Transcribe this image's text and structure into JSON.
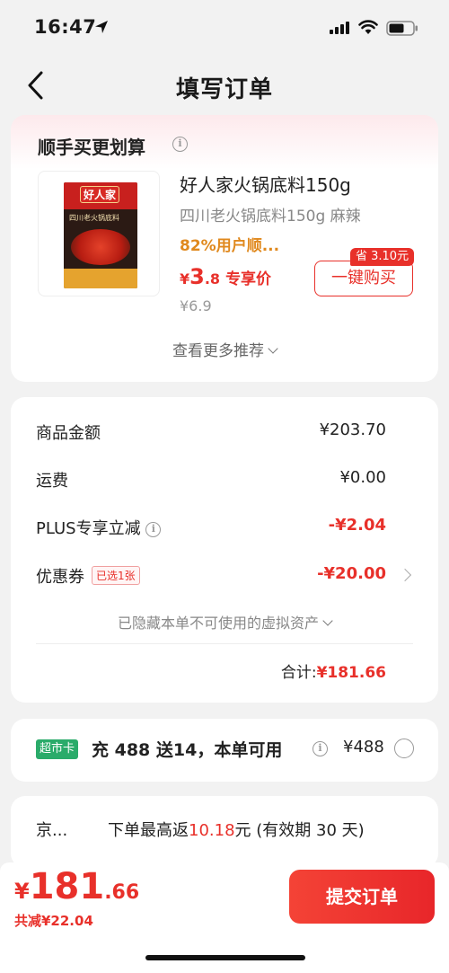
{
  "status": {
    "time": "16:47"
  },
  "nav": {
    "title": "填写订单"
  },
  "recommend": {
    "title": "顺手买更划算",
    "product": {
      "name": "好人家火锅底料150g",
      "subtitle": "四川老火锅底料150g 麻辣",
      "rating": "82%用户顺...",
      "price_yen": "¥",
      "price_int": "3",
      "price_dec": ".8",
      "price_tag": "专享价",
      "orig_price": "¥6.9",
      "save_badge": "省 3.10元",
      "buy_label": "一键购买",
      "pkg_brand": "好人家",
      "pkg_name": "四川老火锅底料"
    },
    "more_label": "查看更多推荐"
  },
  "summary": {
    "rows": [
      {
        "label": "商品金额",
        "value": "¥203.70"
      },
      {
        "label": "运费",
        "value": "¥0.00"
      },
      {
        "label": "PLUS专享立减",
        "value": "-¥2.04"
      },
      {
        "label": "优惠券",
        "badge": "已选1张",
        "value": "-¥20.00"
      }
    ],
    "hidden_assets": "已隐藏本单不可使用的虚拟资产",
    "total_label": "合计:",
    "total_value": "¥181.66"
  },
  "vip": {
    "tag": "超市卡",
    "text": "充 488 送14，本单可用",
    "price": "¥488"
  },
  "rebate": {
    "left": "京...",
    "prefix": "下单最高返",
    "amount": "10.18",
    "suffix": "元 (有效期 30 天)"
  },
  "footer": {
    "yen": "¥",
    "price_int": "181",
    "price_dec": ".66",
    "saved": "共减¥22.04",
    "submit_label": "提交订单"
  },
  "colors": {
    "accent": "#e8302a",
    "green_tag": "#2aab6a"
  }
}
